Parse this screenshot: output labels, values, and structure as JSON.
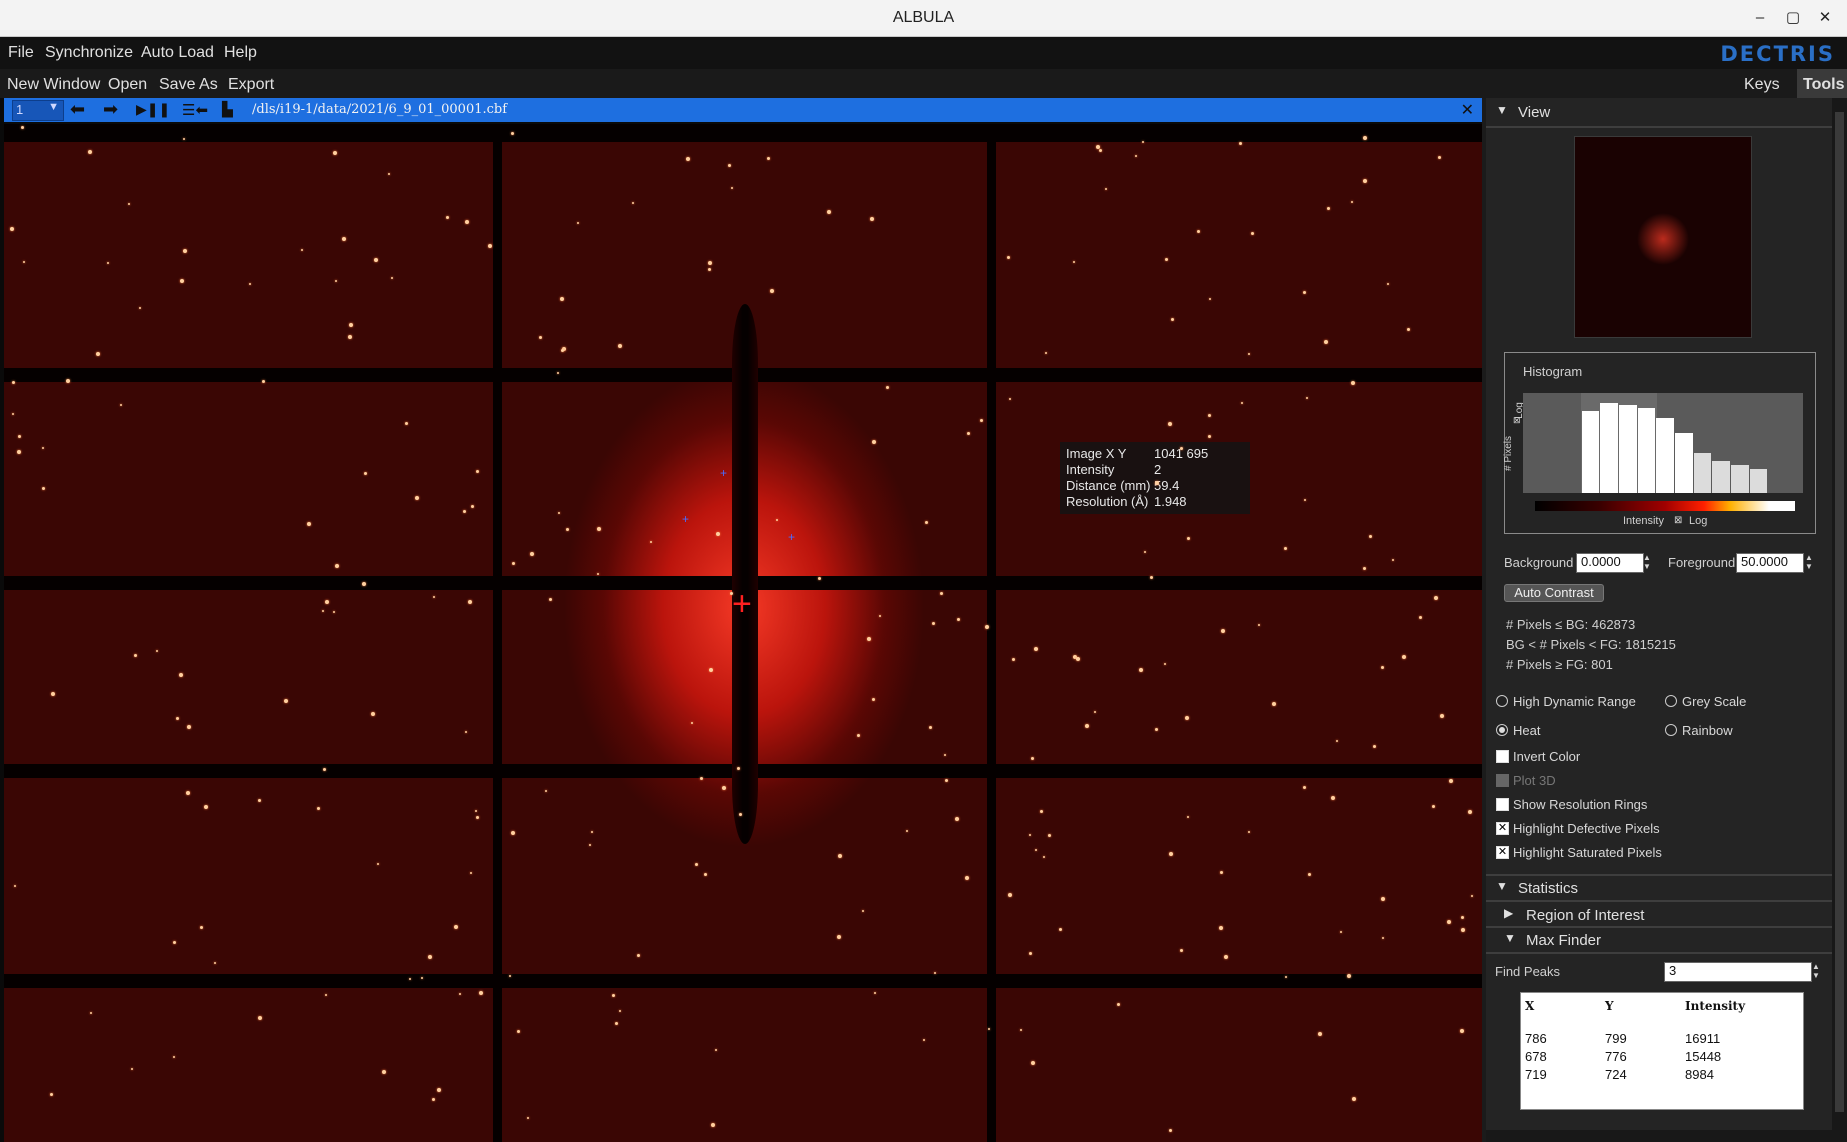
{
  "window": {
    "title": "ALBULA",
    "controls": [
      "–",
      "▢",
      "✕"
    ]
  },
  "menubar": {
    "items": [
      "File",
      "Synchronize",
      "Auto Load",
      "Help"
    ],
    "brand": "DECTRIS"
  },
  "toolbar": {
    "items": [
      "New Window",
      "Open",
      "Save As",
      "Export"
    ],
    "tabs": [
      "Keys",
      "Tools"
    ],
    "active_tab": "Tools"
  },
  "image_window": {
    "frame": "1",
    "file_path": "/dls/i19-1/data/2021/6_9_01_00001.cbf",
    "tooltip": {
      "labels": [
        "Image X Y",
        "Intensity",
        "Distance (mm)",
        "Resolution (Å)"
      ],
      "values": [
        "1041 695",
        "2",
        "59.4",
        "1.948"
      ]
    }
  },
  "panel": {
    "view_header": "View",
    "histogram": {
      "title": "Histogram",
      "y_label": "# Pixels",
      "y_log_label": "Log",
      "x_label": "Intensity",
      "x_log_label": "Log",
      "bar_levels": [
        0.0,
        0.82,
        0.9,
        0.88,
        0.85,
        0.75,
        0.6,
        0.4,
        0.32,
        0.28,
        0.24,
        0.2,
        0.17,
        0.13,
        0.09
      ]
    },
    "contrast": {
      "background_label": "Background",
      "background_value": "0.0000",
      "foreground_label": "Foreground",
      "foreground_value": "50.0000",
      "auto_contrast": "Auto Contrast",
      "stats": [
        "# Pixels ≤ BG: 462873",
        "BG < # Pixels < FG: 1815215",
        "# Pixels ≥ FG: 801"
      ]
    },
    "color_modes": [
      {
        "label": "High Dynamic Range",
        "selected": false
      },
      {
        "label": "Grey Scale",
        "selected": false
      },
      {
        "label": "Heat",
        "selected": true
      },
      {
        "label": "Rainbow",
        "selected": false
      }
    ],
    "options": [
      {
        "label": "Invert Color",
        "checked": false,
        "enabled": true
      },
      {
        "label": "Plot 3D",
        "checked": false,
        "enabled": false
      },
      {
        "label": "Show Resolution Rings",
        "checked": false,
        "enabled": true
      },
      {
        "label": "Highlight Defective Pixels",
        "checked": true,
        "enabled": true
      },
      {
        "label": "Highlight Saturated Pixels",
        "checked": true,
        "enabled": true
      }
    ],
    "statistics_header": "Statistics",
    "roi_header": "Region of Interest",
    "maxfinder_header": "Max Finder",
    "find_peaks_label": "Find Peaks",
    "find_peaks_value": "3",
    "peaks": {
      "headers": [
        "X",
        "Y",
        "Intensity"
      ],
      "rows": [
        [
          "786",
          "799",
          "16911"
        ],
        [
          "678",
          "776",
          "15448"
        ],
        [
          "719",
          "724",
          "8984"
        ]
      ]
    }
  },
  "colors": {
    "accent": "#1e6fe0",
    "brand": "#2a6fc6",
    "heat_core": "#ff3c28"
  }
}
